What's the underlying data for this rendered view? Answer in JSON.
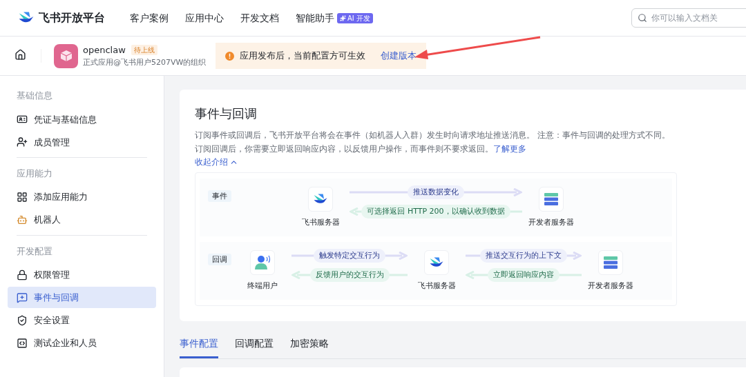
{
  "brand": {
    "name": "飞书开放平台"
  },
  "nav": [
    {
      "label": "客户案例"
    },
    {
      "label": "应用中心"
    },
    {
      "label": "开发文档"
    },
    {
      "label": "智能助手",
      "badge": "AI 开发"
    }
  ],
  "search": {
    "placeholder": "你可以输入文档关"
  },
  "app": {
    "name": "openclaw",
    "status": "待上线",
    "org": "正式应用@飞书用户5207VW的组织"
  },
  "notice": {
    "text": "应用发布后，当前配置方可生效",
    "link": "创建版本"
  },
  "sidebar": {
    "sections": [
      {
        "title": "基础信息",
        "items": [
          {
            "label": "凭证与基础信息",
            "kind": "card",
            "selected": false
          },
          {
            "label": "成员管理",
            "kind": "user-plus",
            "selected": false
          }
        ]
      },
      {
        "title": "应用能力",
        "items": [
          {
            "label": "添加应用能力",
            "kind": "grid",
            "selected": false
          },
          {
            "label": "机器人",
            "kind": "robot",
            "selected": false
          }
        ]
      },
      {
        "title": "开发配置",
        "items": [
          {
            "label": "权限管理",
            "kind": "lock",
            "selected": false
          },
          {
            "label": "事件与回调",
            "kind": "event",
            "selected": true
          },
          {
            "label": "安全设置",
            "kind": "shield",
            "selected": false
          },
          {
            "label": "测试企业和人员",
            "kind": "code",
            "selected": false
          }
        ]
      }
    ]
  },
  "page": {
    "title": "事件与回调",
    "description": "订阅事件或回调后，飞书开放平台将会在事件（如机器人入群）发生时向请求地址推送消息。 注意：事件与回调的处理方式不同。订阅回调后，你需要立即返回响应内容，以反馈用户操作，而事件则不要求返回。",
    "link": "了解更多",
    "collapse": "收起介绍"
  },
  "diagram": [
    {
      "label": "事件",
      "nodes": [
        {
          "kind": "feishu",
          "label": "飞书服务器"
        },
        {
          "kind": "server",
          "label": "开发者服务器"
        }
      ],
      "links": [
        {
          "forward": "推送数据变化",
          "back": "可选择返回 HTTP 200，以确认收到数据"
        }
      ]
    },
    {
      "label": "回调",
      "nodes": [
        {
          "kind": "user",
          "label": "终端用户"
        },
        {
          "kind": "feishu",
          "label": "飞书服务器"
        },
        {
          "kind": "server",
          "label": "开发者服务器"
        }
      ],
      "links": [
        {
          "forward": "触发特定交互行为",
          "back": "反馈用户的交互行为"
        },
        {
          "forward": "推送交互行为的上下文",
          "back": "立即返回响应内容"
        }
      ]
    }
  ],
  "tabs": [
    {
      "label": "事件配置",
      "selected": true
    },
    {
      "label": "回调配置",
      "selected": false
    },
    {
      "label": "加密策略",
      "selected": false
    }
  ]
}
